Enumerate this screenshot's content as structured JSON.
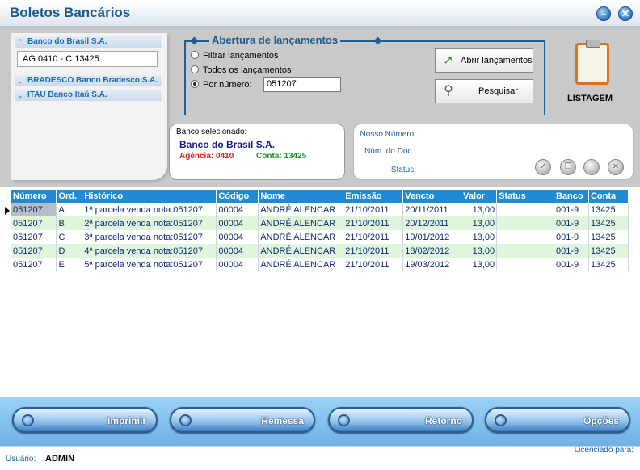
{
  "window": {
    "title": "Boletos Bancários",
    "min_glyph": "–",
    "close_glyph": "✕"
  },
  "banks": [
    {
      "name": "Banco do Brasil S.A.",
      "detail": "AG 0410 - C 13425",
      "chev": "⌃"
    },
    {
      "name": "BRADESCO Banco Bradesco S.A.",
      "chev": "⌄"
    },
    {
      "name": "ITAU Banco Itaú S.A.",
      "chev": "⌄"
    }
  ],
  "abertura": {
    "title": "Abertura de lançamentos",
    "options": [
      "Filtrar lançamentos",
      "Todos os lançamentos",
      "Por número:"
    ],
    "selected_option": 2,
    "numero_value": "051207",
    "btn_abrir": "Abrir lançamentos",
    "btn_pesquisar": "Pesquisar"
  },
  "listagem": {
    "label": "LISTAGEM"
  },
  "selected_bank": {
    "label": "Banco selecionado:",
    "name": "Banco do Brasil S.A.",
    "agencia": "Agência: 0410",
    "conta": "Conta: 13425"
  },
  "nosso_numero": {
    "labels": [
      "Nosso Número:",
      "Núm. do Doc.:",
      "Status:"
    ]
  },
  "table": {
    "columns": [
      "Número",
      "Ord.",
      "Histórico",
      "Código",
      "Nome",
      "Emissão",
      "Vencto",
      "Valor",
      "Status",
      "Banco",
      "Conta"
    ],
    "rows": [
      [
        "051207",
        "A",
        "1ª parcela venda nota:051207",
        "00004",
        "ANDRÉ ALENCAR",
        "21/10/2011",
        "20/11/2011",
        "13,00",
        "",
        "001-9",
        "13425"
      ],
      [
        "051207",
        "B",
        "2ª parcela venda nota:051207",
        "00004",
        "ANDRÉ ALENCAR",
        "21/10/2011",
        "20/12/2011",
        "13,00",
        "",
        "001-9",
        "13425"
      ],
      [
        "051207",
        "C",
        "3ª parcela venda nota:051207",
        "00004",
        "ANDRÉ ALENCAR",
        "21/10/2011",
        "19/01/2012",
        "13,00",
        "",
        "001-9",
        "13425"
      ],
      [
        "051207",
        "D",
        "4ª parcela venda nota:051207",
        "00004",
        "ANDRÉ ALENCAR",
        "21/10/2011",
        "18/02/2012",
        "13,00",
        "",
        "001-9",
        "13425"
      ],
      [
        "051207",
        "E",
        "5ª parcela venda nota:051207",
        "00004",
        "ANDRÉ ALENCAR",
        "21/10/2011",
        "19/03/2012",
        "13,00",
        "",
        "001-9",
        "13425"
      ]
    ]
  },
  "bottom_buttons": [
    "Imprimir",
    "Remessa",
    "Retorno",
    "Opções"
  ],
  "status": {
    "usuario_label": "Usuário:",
    "usuario": "ADMIN",
    "licenciado": "Licenciado para:"
  }
}
